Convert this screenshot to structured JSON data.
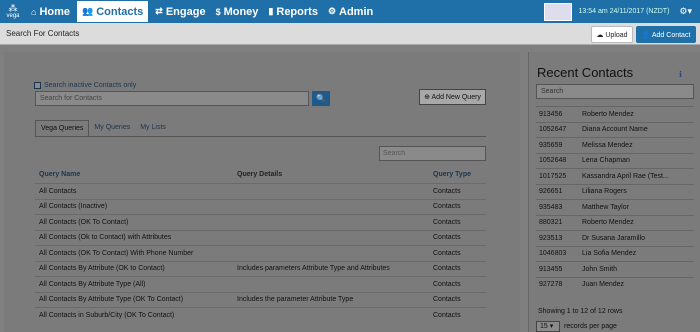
{
  "brand": {
    "text": "vega"
  },
  "nav": [
    {
      "icon": "⌂",
      "label": "Home"
    },
    {
      "icon": "👥",
      "label": "Contacts"
    },
    {
      "icon": "⇄",
      "label": "Engage"
    },
    {
      "icon": "$",
      "label": "Money"
    },
    {
      "icon": "▮",
      "label": "Reports"
    },
    {
      "icon": "⚙",
      "label": "Admin"
    }
  ],
  "clock": "13:54 am 24/11/2017 (NZDT)",
  "gear": "⚙▾",
  "subbar": {
    "title": "Search For Contacts",
    "upload": "☁ Upload",
    "add_contact": "👤 Add Contact"
  },
  "main": {
    "inactive_label": "Search inactive Contacts only",
    "search_placeholder": "Search for Contacts",
    "search_icon": "🔍",
    "add_query": "⊕ Add New Query",
    "tabs": [
      "Vega Queries",
      "My Queries",
      "My Lists"
    ],
    "query_search_placeholder": "Search",
    "table": {
      "headers": [
        "Query Name",
        "Query Details",
        "Query Type"
      ],
      "rows": [
        [
          "All Contacts",
          "",
          "Contacts"
        ],
        [
          "All Contacts (Inactive)",
          "",
          "Contacts"
        ],
        [
          "All Contacts (OK To Contact)",
          "",
          "Contacts"
        ],
        [
          "All Contacts (Ok to Contact) with Attributes",
          "",
          "Contacts"
        ],
        [
          "All Contacts (OK To Contact) With Phone Number",
          "",
          "Contacts"
        ],
        [
          "All Contacts By Attribute (OK to Contact)",
          "Includes parameters Attribute Type and Attributes",
          "Contacts"
        ],
        [
          "All Contacts By Attribute Type (All)",
          "",
          "Contacts"
        ],
        [
          "All Contacts By Attribute Type (OK To Contact)",
          "Includes the parameter Attribute Type",
          "Contacts"
        ],
        [
          "All Contacts in Suburb/City (OK To Contact)",
          "",
          "Contacts"
        ]
      ]
    }
  },
  "recent": {
    "title": "Recent Contacts",
    "info": "ℹ",
    "search_placeholder": "Search",
    "rows": [
      [
        "913456",
        "Roberto Mendez"
      ],
      [
        "1052647",
        "Diana Account Name"
      ],
      [
        "935659",
        "Melissa Mendez"
      ],
      [
        "1052648",
        "Lena Chapman"
      ],
      [
        "1017525",
        "Kassandra April Rae (Test..."
      ],
      [
        "926651",
        "Liliana Rogers"
      ],
      [
        "935483",
        "Matthew Taylor"
      ],
      [
        "880321",
        "Roberto Mendez"
      ],
      [
        "923513",
        "Dr Susana Jaramillo"
      ],
      [
        "1046803",
        "Lia Sofia Mendez"
      ],
      [
        "913455",
        "John Smith"
      ],
      [
        "927278",
        "Juan Mendez"
      ]
    ],
    "showing": "Showing 1 to 12 of 12 rows",
    "page_size": "15 ▾",
    "per_page": "records per page"
  }
}
